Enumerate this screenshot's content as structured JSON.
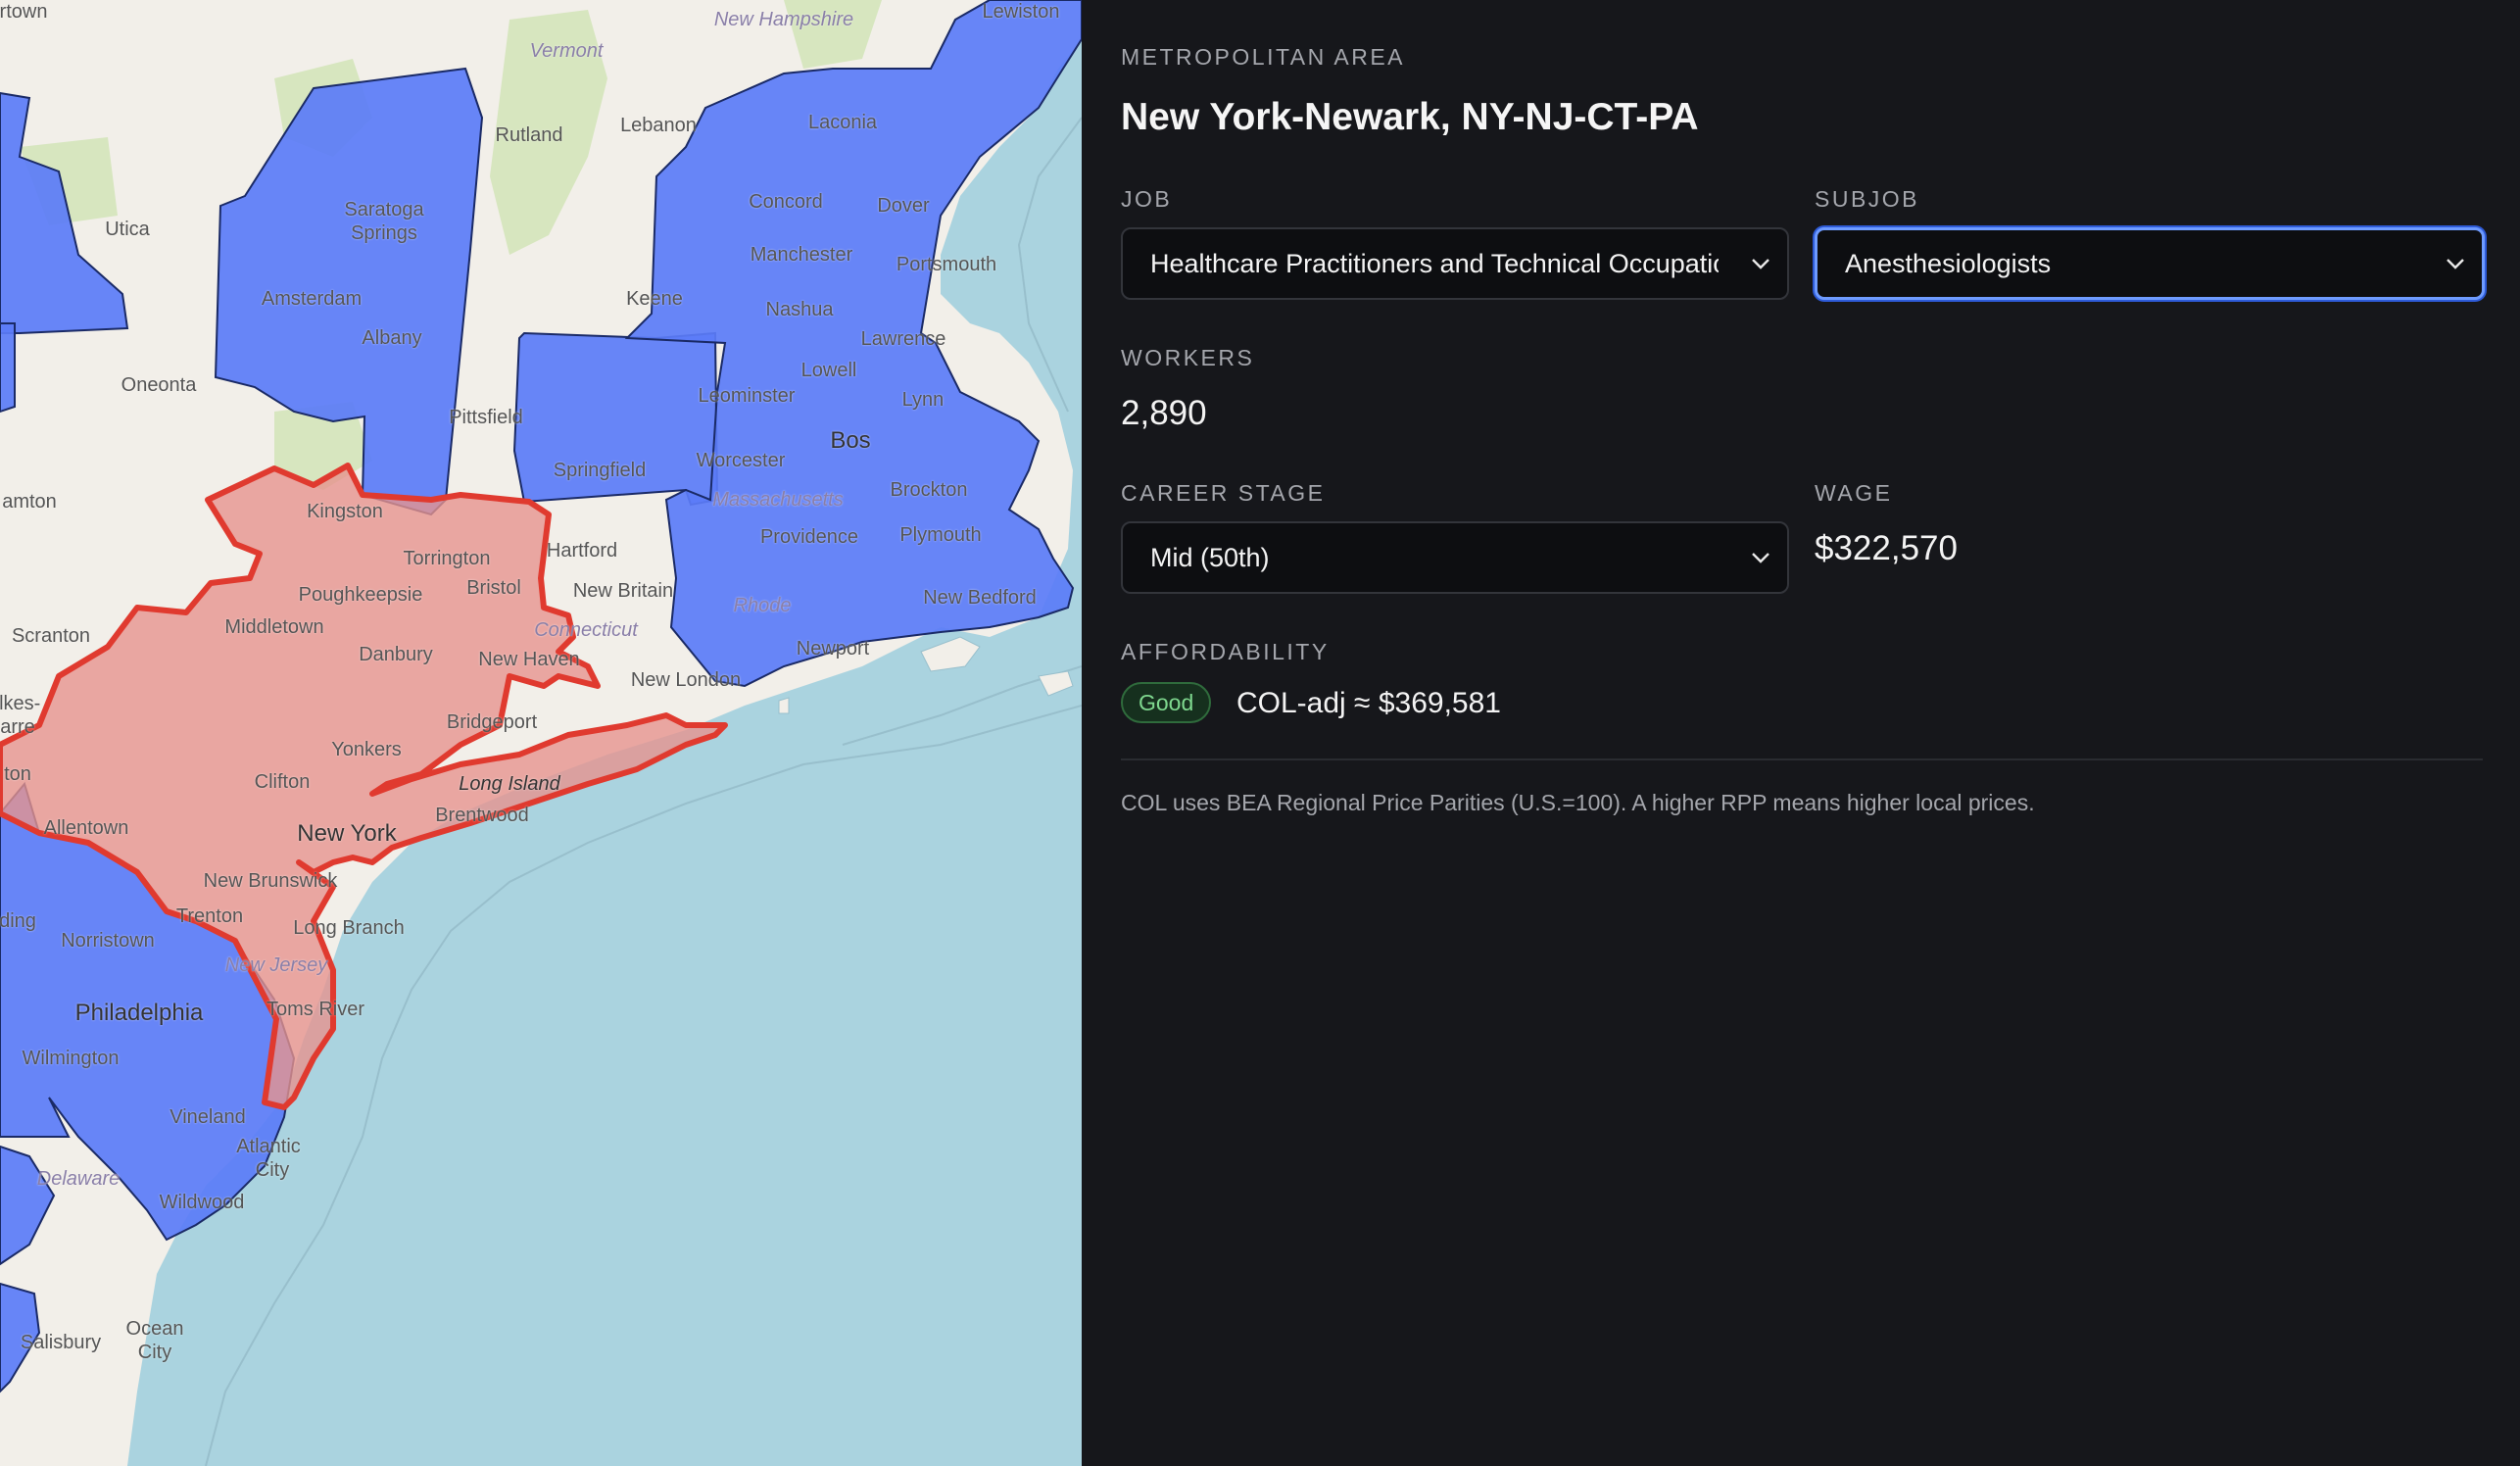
{
  "colors": {
    "panel_bg": "#16171b",
    "water": "#aad3df",
    "land": "#f2efe9",
    "metro_fill": "#5b7cf7",
    "selected_fill": "#e6938f",
    "selected_stroke": "#e03a2f",
    "focus_ring": "#6e9bff",
    "badge_good": "#7fd88f"
  },
  "map": {
    "places": [
      {
        "key": "lewiston",
        "label": "Lewiston"
      },
      {
        "key": "new_hampshire",
        "label": "New Hampshire"
      },
      {
        "key": "vermont",
        "label": "Vermont"
      },
      {
        "key": "rutland",
        "label": "Rutland"
      },
      {
        "key": "lebanon",
        "label": "Lebanon"
      },
      {
        "key": "laconia",
        "label": "Laconia"
      },
      {
        "key": "saratoga",
        "label": "Saratoga"
      },
      {
        "key": "springs",
        "label": "Springs"
      },
      {
        "key": "utica",
        "label": "Utica"
      },
      {
        "key": "amsterdam",
        "label": "Amsterdam"
      },
      {
        "key": "albany",
        "label": "Albany"
      },
      {
        "key": "keene",
        "label": "Keene"
      },
      {
        "key": "concord",
        "label": "Concord"
      },
      {
        "key": "dover",
        "label": "Dover"
      },
      {
        "key": "manchester",
        "label": "Manchester"
      },
      {
        "key": "portsmouth",
        "label": "Portsmouth"
      },
      {
        "key": "nashua",
        "label": "Nashua"
      },
      {
        "key": "lawrence",
        "label": "Lawrence"
      },
      {
        "key": "lowell",
        "label": "Lowell"
      },
      {
        "key": "oneonta",
        "label": "Oneonta"
      },
      {
        "key": "pittsfield",
        "label": "Pittsfield"
      },
      {
        "key": "leominster",
        "label": "Leominster"
      },
      {
        "key": "lynn",
        "label": "Lynn"
      },
      {
        "key": "boston",
        "label": "Bos"
      },
      {
        "key": "worcester",
        "label": "Worcester"
      },
      {
        "key": "springfield",
        "label": "Springfield"
      },
      {
        "key": "brockton",
        "label": "Brockton"
      },
      {
        "key": "massachusetts",
        "label": "Massachusetts"
      },
      {
        "key": "providence",
        "label": "Providence"
      },
      {
        "key": "plymouth",
        "label": "Plymouth"
      },
      {
        "key": "kingston",
        "label": "Kingston"
      },
      {
        "key": "torrington",
        "label": "Torrington"
      },
      {
        "key": "hartford",
        "label": "Hartford"
      },
      {
        "key": "binghamton",
        "label": "amton"
      },
      {
        "key": "poughkeepsie",
        "label": "Poughkeepsie"
      },
      {
        "key": "bristol",
        "label": "Bristol"
      },
      {
        "key": "new_britain",
        "label": "New Britain"
      },
      {
        "key": "new_bedford",
        "label": "New Bedford"
      },
      {
        "key": "middletown",
        "label": "Middletown"
      },
      {
        "key": "connecticut",
        "label": "Connecticut"
      },
      {
        "key": "rhode",
        "label": "Rhode"
      },
      {
        "key": "newport",
        "label": "Newport"
      },
      {
        "key": "scranton",
        "label": "Scranton"
      },
      {
        "key": "danbury",
        "label": "Danbury"
      },
      {
        "key": "new_haven",
        "label": "New Haven"
      },
      {
        "key": "new_london",
        "label": "New London"
      },
      {
        "key": "wilkes",
        "label": "ilkes-"
      },
      {
        "key": "barre",
        "label": "arre"
      },
      {
        "key": "bridgeport",
        "label": "Bridgeport"
      },
      {
        "key": "yonkers",
        "label": "Yonkers"
      },
      {
        "key": "long_island",
        "label": "Long Island"
      },
      {
        "key": "clifton",
        "label": "Clifton"
      },
      {
        "key": "allentown",
        "label": "Allentown"
      },
      {
        "key": "brentwood",
        "label": "Brentwood"
      },
      {
        "key": "new_york",
        "label": "New York"
      },
      {
        "key": "new_brunswick",
        "label": "New Brunswick"
      },
      {
        "key": "trenton",
        "label": "Trenton"
      },
      {
        "key": "long_branch",
        "label": "Long Branch"
      },
      {
        "key": "norristown",
        "label": "Norristown"
      },
      {
        "key": "new_jersey",
        "label": "New Jersey"
      },
      {
        "key": "toms_river",
        "label": "Toms River"
      },
      {
        "key": "philadelphia",
        "label": "Philadelphia"
      },
      {
        "key": "wilmington",
        "label": "Wilmington"
      },
      {
        "key": "vineland",
        "label": "Vineland"
      },
      {
        "key": "atlantic",
        "label": "Atlantic"
      },
      {
        "key": "city",
        "label": "City"
      },
      {
        "key": "delaware",
        "label": "Delaware"
      },
      {
        "key": "wildwood",
        "label": "Wildwood"
      },
      {
        "key": "salisbury",
        "label": "Salisbury"
      },
      {
        "key": "ocean",
        "label": "Ocean"
      },
      {
        "key": "ocean_city",
        "label": "City"
      },
      {
        "key": "reading",
        "label": "ding"
      },
      {
        "key": "ton",
        "label": "ton"
      },
      {
        "key": "rtown",
        "label": "rtown"
      }
    ]
  },
  "panel": {
    "metro_label": "METROPOLITAN AREA",
    "metro_name": "New York-Newark, NY-NJ-CT-PA",
    "job_label": "JOB",
    "job_value": "Healthcare Practitioners and Technical Occupations",
    "subjob_label": "SUBJOB",
    "subjob_value": "Anesthesiologists",
    "workers_label": "WORKERS",
    "workers_value": "2,890",
    "career_label": "CAREER STAGE",
    "career_value": "Mid (50th)",
    "wage_label": "WAGE",
    "wage_value": "$322,570",
    "afford_label": "AFFORDABILITY",
    "afford_badge": "Good",
    "col_adj": "COL-adj ≈ $369,581",
    "note": "COL uses BEA Regional Price Parities (U.S.=100). A higher RPP means higher local prices."
  }
}
